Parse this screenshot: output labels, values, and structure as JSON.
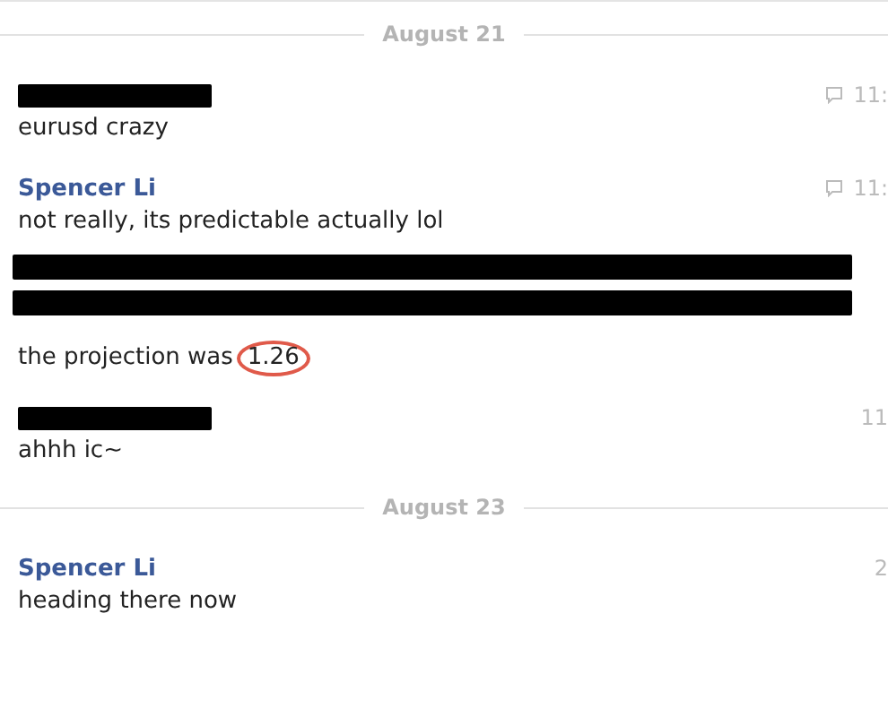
{
  "items": [
    {
      "kind": "date",
      "label": "August 21"
    },
    {
      "kind": "message",
      "sender": {
        "redacted": true
      },
      "time": "11:",
      "comment_icon": true,
      "lines": [
        {
          "kind": "text",
          "text": "eurusd crazy"
        }
      ]
    },
    {
      "kind": "message",
      "sender": {
        "redacted": false,
        "name": "Spencer Li"
      },
      "time": "11:",
      "comment_icon": true,
      "lines": [
        {
          "kind": "text",
          "text": "not really, its predictable actually lol"
        }
      ]
    },
    {
      "kind": "message",
      "lines": [
        {
          "kind": "redacted"
        },
        {
          "kind": "redacted"
        },
        {
          "kind": "text",
          "text": "the projection was",
          "circled": "1.26"
        }
      ]
    },
    {
      "kind": "message",
      "sender": {
        "redacted": true
      },
      "time": "11",
      "comment_icon": false,
      "lines": [
        {
          "kind": "text",
          "text": "ahhh ic~"
        }
      ]
    },
    {
      "kind": "date",
      "label": "August 23"
    },
    {
      "kind": "message",
      "sender": {
        "redacted": false,
        "name": "Spencer Li"
      },
      "time": "2",
      "comment_icon": false,
      "lines": [
        {
          "kind": "text",
          "text": "heading there now"
        }
      ]
    }
  ]
}
